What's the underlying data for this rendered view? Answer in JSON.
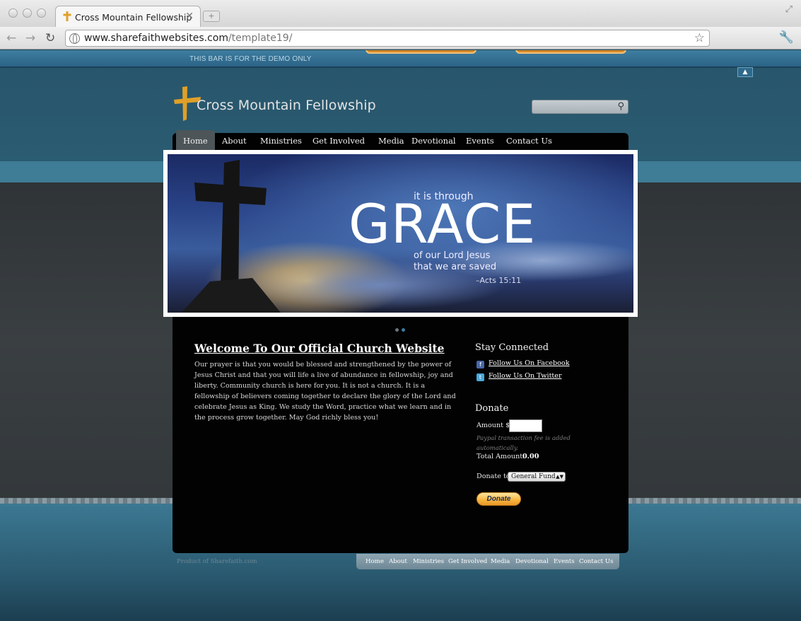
{
  "browser": {
    "tab_title": "Cross Mountain Fellowship",
    "tab_close": "✕",
    "new_tab": "+",
    "url_domain": "www.sharefaithwebsites.com",
    "url_path": "/template19/"
  },
  "demo_bar": {
    "text": "THIS BAR IS FOR THE DEMO ONLY"
  },
  "site": {
    "logo_text": "Cross Mountain Fellowship",
    "search_placeholder": ""
  },
  "nav": {
    "items": [
      "Home",
      "About",
      "Ministries",
      "Get Involved",
      "Media",
      "Devotional",
      "Events",
      "Contact Us"
    ],
    "active": "Home"
  },
  "slide": {
    "line1": "it is through",
    "headline": "GRACE",
    "line2": "of our Lord Jesus",
    "line3": "that we are saved",
    "reference": "–Acts 15:11"
  },
  "welcome": {
    "title": "Welcome To Our Official Church Website",
    "body": "Our prayer is that you would be blessed and strengthened by the power of Jesus Christ and that you will life a live of abundance in fellowship, joy and liberty. Community church is here for you. It is not a church. It is a fellowship of believers coming together to declare the glory of the Lord and celebrate Jesus as King. We study the Word, practice what we learn and in the process grow together. May God richly bless you!"
  },
  "sidebar": {
    "stay_connected": "Stay Connected",
    "facebook": "Follow Us On Facebook",
    "twitter": "Follow Us On Twitter",
    "donate_heading": "Donate",
    "amount_label": "Amount $",
    "fee_note": "Paypal transaction fee is added automatically.",
    "total_label": "Total Amount:",
    "total_value": "0.00",
    "donate_to_label": "Donate to",
    "fund_selected": "General Fund",
    "donate_button": "Donate"
  },
  "footer": {
    "credit": "Product of Sharefaith.com",
    "nav": [
      "Home",
      "About",
      "Ministries",
      "Get Involved",
      "Media",
      "Devotional",
      "Events",
      "Contact Us"
    ]
  },
  "colors": {
    "accent_gold": "#e0a028",
    "page_blue": "#2a5c72",
    "panel_black": "#020202"
  }
}
